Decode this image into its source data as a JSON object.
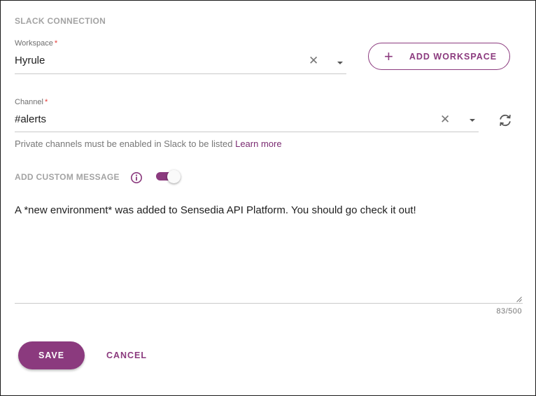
{
  "section": {
    "title": "SLACK CONNECTION"
  },
  "workspace": {
    "label": "Workspace",
    "required_mark": "*",
    "value": "Hyrule",
    "clear_icon": "close-icon",
    "dropdown_icon": "caret-down-icon"
  },
  "add_workspace": {
    "label": "ADD WORKSPACE",
    "icon": "plus-icon"
  },
  "channel": {
    "label": "Channel",
    "required_mark": "*",
    "value": "#alerts",
    "clear_icon": "close-icon",
    "dropdown_icon": "caret-down-icon",
    "refresh_icon": "refresh-icon"
  },
  "hint": {
    "text": "Private channels must be enabled in Slack to be listed",
    "link": "Learn more"
  },
  "custom_message": {
    "label": "ADD CUSTOM MESSAGE",
    "info_icon": "info-icon",
    "toggle_on": true,
    "text": "A *new environment* was added to Sensedia API Platform. You should go check it out!",
    "counter": "83/500"
  },
  "actions": {
    "save": "SAVE",
    "cancel": "CANCEL"
  },
  "colors": {
    "accent": "#8b3a7e",
    "required": "#e53935",
    "muted": "#a3a3a3",
    "border": "#1a1a1a"
  }
}
